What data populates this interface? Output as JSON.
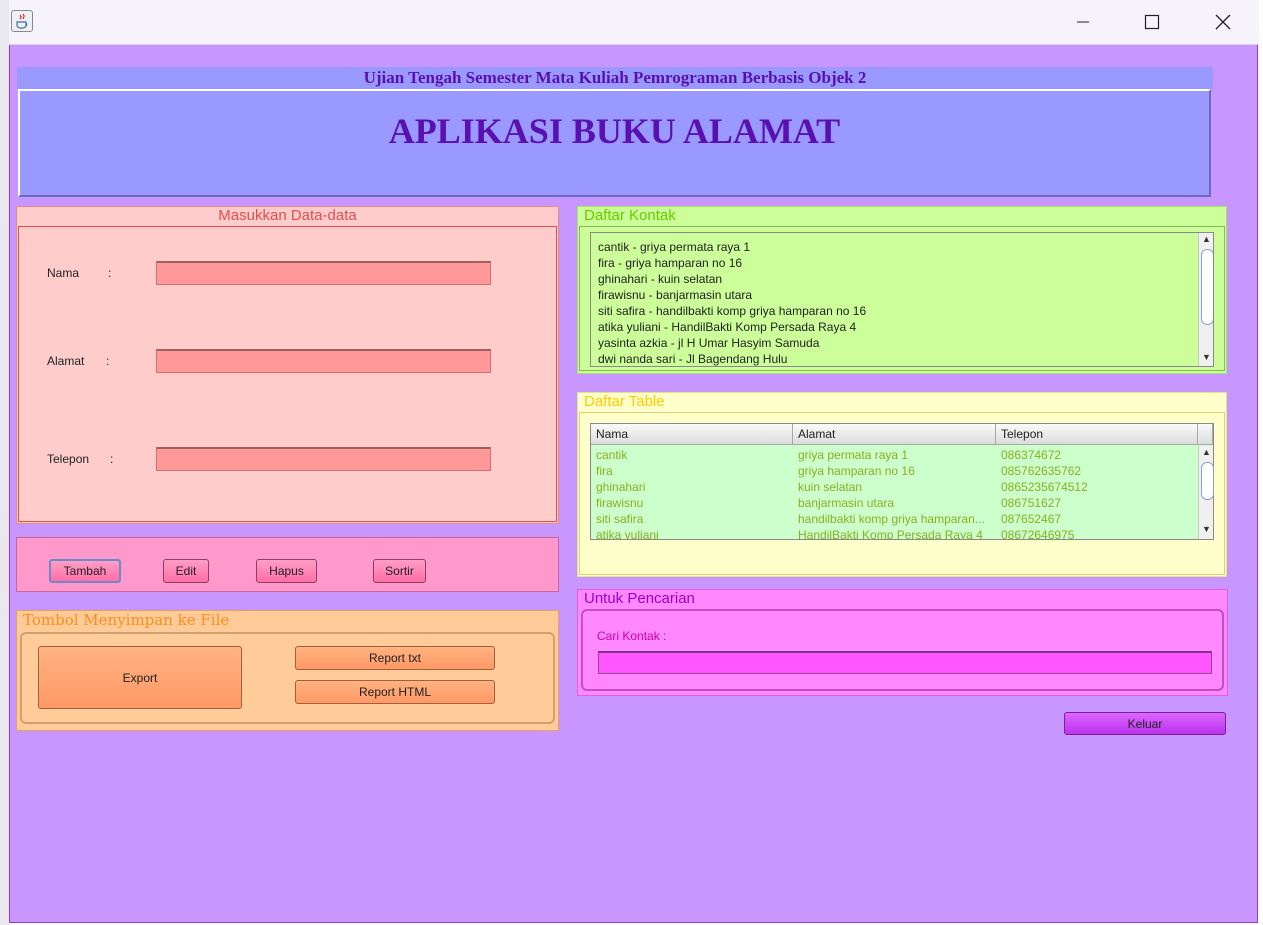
{
  "window": {
    "app_icon": "java-coffee-icon",
    "controls": [
      "minimize-icon",
      "maximize-icon",
      "close-icon"
    ]
  },
  "header": {
    "subtitle": "Ujian Tengah Semester Mata Kuliah Pemrograman Berbasis Objek 2",
    "title": "APLIKASI BUKU ALAMAT"
  },
  "input_panel": {
    "title": "Masukkan Data-data",
    "fields": [
      {
        "label": "Nama",
        "colon": ":",
        "value": ""
      },
      {
        "label": "Alamat",
        "colon": ":",
        "value": ""
      },
      {
        "label": "Telepon",
        "colon": ":",
        "value": ""
      }
    ]
  },
  "actions": {
    "tambah": "Tambah",
    "edit": "Edit",
    "hapus": "Hapus",
    "sortir": "Sortir"
  },
  "save_panel": {
    "title": "Tombol Menyimpan ke File",
    "export": "Export",
    "report_txt": "Report txt",
    "report_html": "Report HTML"
  },
  "kontak": {
    "title": "Daftar Kontak",
    "items": [
      "cantik - griya permata raya 1",
      "fira - griya hamparan no 16",
      "ghinahari - kuin selatan",
      "firawisnu - banjarmasin utara",
      "siti safira - handilbakti komp griya hamparan no 16",
      "atika yuliani - HandilBakti Komp Persada Raya 4",
      "yasinta azkia - jl H Umar Hasyim Samuda",
      "dwi nanda sari - Jl Bagendang Hulu"
    ]
  },
  "table": {
    "title": "Daftar Table",
    "columns": [
      "Nama",
      "Alamat",
      "Telepon"
    ],
    "rows": [
      [
        "cantik",
        "griya permata raya 1",
        "086374672"
      ],
      [
        "fira",
        "griya hamparan no 16",
        "085762635762"
      ],
      [
        "ghinahari",
        "kuin selatan",
        "0865235674512"
      ],
      [
        "firawisnu",
        "banjarmasin utara",
        "086751627"
      ],
      [
        "siti safira",
        "handilbakti komp griya hamparan...",
        "087652467"
      ],
      [
        "atika yuliani",
        "HandilBakti Komp Persada Raya 4",
        "08672646975"
      ]
    ]
  },
  "search": {
    "title": "Untuk Pencarian",
    "label": "Cari Kontak  :",
    "value": ""
  },
  "keluar": "Keluar"
}
